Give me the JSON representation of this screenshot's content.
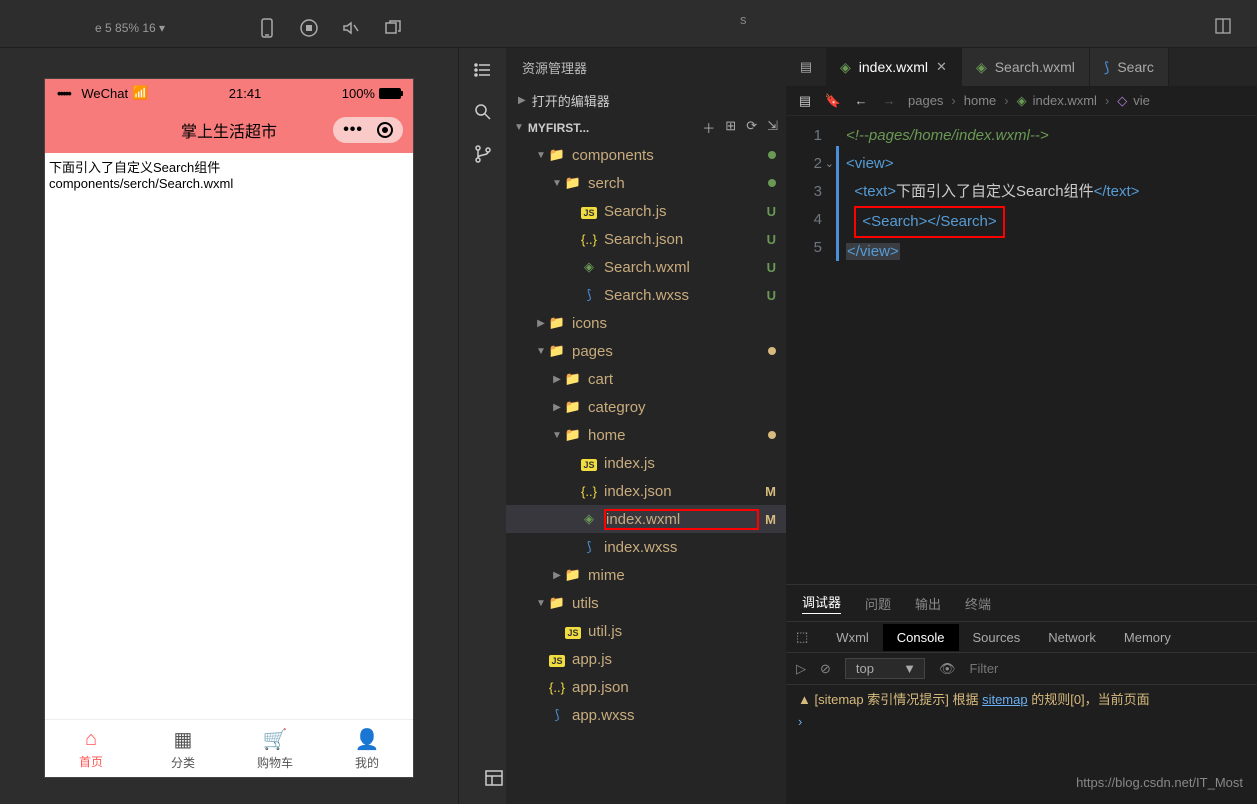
{
  "toolbar": {
    "left_text": "e 5 85% 16 ▾",
    "s_char": "s"
  },
  "phone": {
    "carrier": "WeChat",
    "time": "21:41",
    "battery": "100%",
    "title": "掌上生活超市",
    "body_line1": "下面引入了自定义Search组件",
    "body_line2": "components/serch/Search.wxml",
    "tabs": [
      {
        "icon": "⌂",
        "label": "首页",
        "active": true
      },
      {
        "icon": "▦",
        "label": "分类"
      },
      {
        "icon": "🛒",
        "label": "购物车"
      },
      {
        "icon": "👤",
        "label": "我的"
      }
    ]
  },
  "explorer": {
    "title": "资源管理器",
    "open_editors": "打开的编辑器",
    "project": "MYFIRST...",
    "tree": [
      {
        "k": "folder",
        "n": "components",
        "d": 1,
        "open": true,
        "dot": "g"
      },
      {
        "k": "folder",
        "n": "serch",
        "d": 2,
        "open": true,
        "dot": "g"
      },
      {
        "k": "js",
        "n": "Search.js",
        "d": 3,
        "s": "U"
      },
      {
        "k": "json",
        "n": "Search.json",
        "d": 3,
        "s": "U"
      },
      {
        "k": "wxml",
        "n": "Search.wxml",
        "d": 3,
        "s": "U"
      },
      {
        "k": "wxss",
        "n": "Search.wxss",
        "d": 3,
        "s": "U"
      },
      {
        "k": "folder",
        "n": "icons",
        "d": 1,
        "open": false,
        "fi": "ico"
      },
      {
        "k": "folder",
        "n": "pages",
        "d": 1,
        "open": true,
        "dot": "y",
        "fi": "pg"
      },
      {
        "k": "folder",
        "n": "cart",
        "d": 2,
        "open": false
      },
      {
        "k": "folder",
        "n": "categroy",
        "d": 2,
        "open": false
      },
      {
        "k": "folder",
        "n": "home",
        "d": 2,
        "open": true,
        "dot": "y"
      },
      {
        "k": "js",
        "n": "index.js",
        "d": 3
      },
      {
        "k": "json",
        "n": "index.json",
        "d": 3,
        "s": "M"
      },
      {
        "k": "wxml",
        "n": "index.wxml",
        "d": 3,
        "s": "M",
        "sel": true,
        "red": true
      },
      {
        "k": "wxss",
        "n": "index.wxss",
        "d": 3
      },
      {
        "k": "folder",
        "n": "mime",
        "d": 2,
        "open": false
      },
      {
        "k": "folder",
        "n": "utils",
        "d": 1,
        "open": true,
        "fi": "ut"
      },
      {
        "k": "js",
        "n": "util.js",
        "d": 2
      },
      {
        "k": "js",
        "n": "app.js",
        "d": 1
      },
      {
        "k": "json",
        "n": "app.json",
        "d": 1
      },
      {
        "k": "wxss",
        "n": "app.wxss",
        "d": 1
      }
    ]
  },
  "tabs": [
    {
      "icon": "wxml",
      "label": "index.wxml",
      "active": true,
      "close": true
    },
    {
      "icon": "wxml",
      "label": "Search.wxml"
    },
    {
      "icon": "wxss",
      "label": "Searc"
    }
  ],
  "breadcrumb": [
    "pages",
    "home",
    "index.wxml",
    "vie"
  ],
  "code": {
    "lines": [
      {
        "n": "1",
        "html": "<span class='c-comment'>&lt;!--pages/home/index.wxml--&gt;</span>"
      },
      {
        "n": "2",
        "html": "<span class='c-tag'>&lt;view&gt;</span>"
      },
      {
        "n": "3",
        "html": "&nbsp;&nbsp;<span class='c-tag'>&lt;text&gt;</span><span class='c-text'>下面引入了自定义Search组件</span><span class='c-tag'>&lt;/text&gt;</span>"
      },
      {
        "n": "4",
        "html": "&nbsp;&nbsp;<span class='hl-box'><span class='c-tag'>&lt;Search&gt;&lt;/Search&gt;</span></span>"
      },
      {
        "n": "5",
        "html": "<span class='cursor-box'><span class='c-tag'>&lt;/view&gt;</span></span>"
      }
    ]
  },
  "panel": {
    "tabs": [
      "调试器",
      "问题",
      "输出",
      "终端"
    ],
    "dev_tabs": [
      "Wxml",
      "Console",
      "Sources",
      "Network",
      "Memory"
    ],
    "dev_active": "Console",
    "context": "top",
    "filter_placeholder": "Filter",
    "warn_prefix": "▲ [sitemap 索引情况提示] 根据 ",
    "warn_link": "sitemap",
    "warn_suffix": " 的规则[0]，当前页面"
  },
  "watermark": "https://blog.csdn.net/IT_Most"
}
